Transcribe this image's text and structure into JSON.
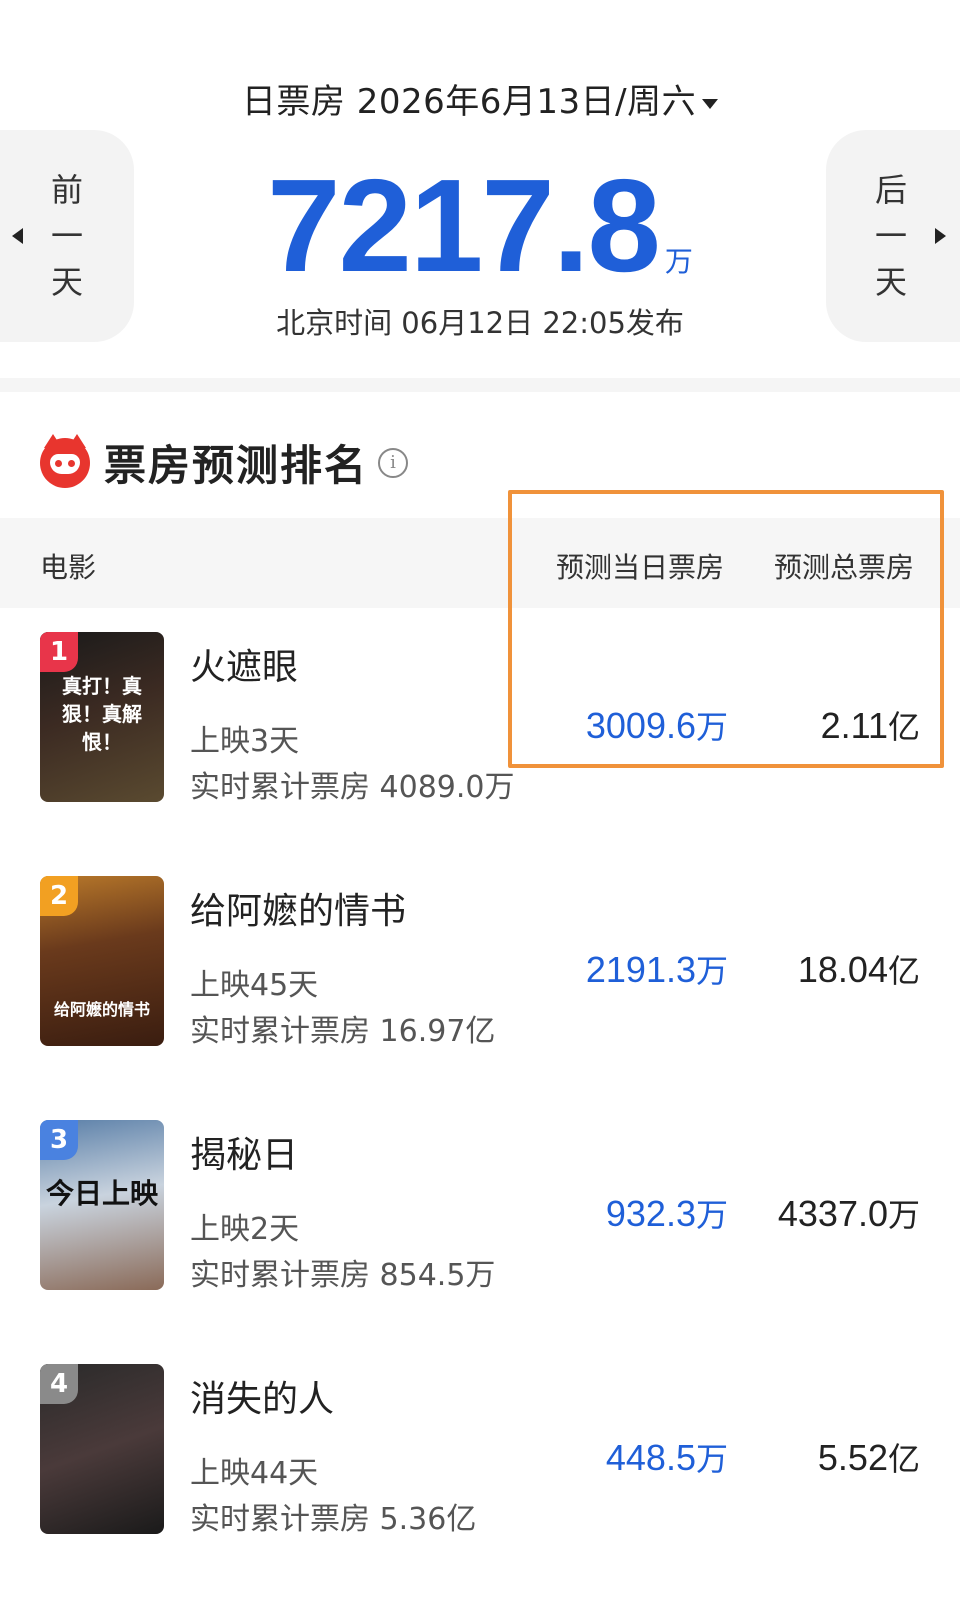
{
  "header": {
    "date_label": "日票房 2026年6月13日/周六",
    "total_value": "7217.8",
    "total_unit": "万",
    "release_info": "北京时间  06月12日  22:05发布",
    "prev_day": "前一天",
    "next_day": "后一天"
  },
  "section": {
    "title": "票房预测排名",
    "info_icon": "i"
  },
  "table": {
    "col_film": "电影",
    "col_day": "预测当日票房",
    "col_total": "预测总票房"
  },
  "movies": [
    {
      "rank": "1",
      "name": "火遮眼",
      "days": "上映3天",
      "cumulative": "实时累计票房 4089.0万",
      "day_value": "3009.6",
      "day_unit": "万",
      "total_value": "2.11",
      "total_unit": "亿",
      "poster_text": "真打！真狠！真解恨！",
      "rank_color": "#e8354a"
    },
    {
      "rank": "2",
      "name": "给阿嬷的情书",
      "days": "上映45天",
      "cumulative": "实时累计票房 16.97亿",
      "day_value": "2191.3",
      "day_unit": "万",
      "total_value": "18.04",
      "total_unit": "亿",
      "poster_text": "给阿嬷的情书",
      "rank_color": "#f2a022"
    },
    {
      "rank": "3",
      "name": "揭秘日",
      "days": "上映2天",
      "cumulative": "实时累计票房 854.5万",
      "day_value": "932.3",
      "day_unit": "万",
      "total_value": "4337.0",
      "total_unit": "万",
      "poster_text": "今日上映",
      "rank_color": "#4a82e0"
    },
    {
      "rank": "4",
      "name": "消失的人",
      "days": "上映44天",
      "cumulative": "实时累计票房 5.36亿",
      "day_value": "448.5",
      "day_unit": "万",
      "total_value": "5.52",
      "total_unit": "亿",
      "poster_text": "",
      "rank_color": "#8a8a8a"
    }
  ],
  "colors": {
    "accent": "#1f5fd8",
    "highlight": "#f0923a"
  }
}
